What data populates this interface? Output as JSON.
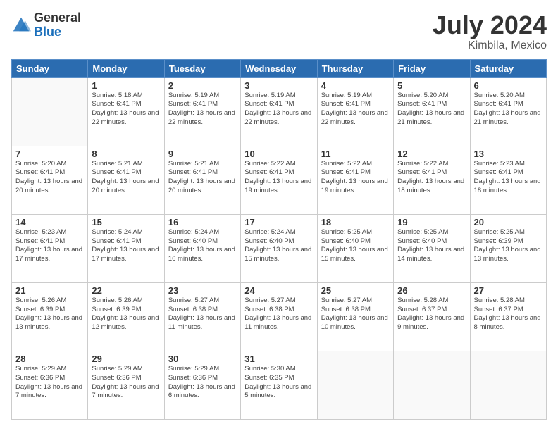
{
  "logo": {
    "general": "General",
    "blue": "Blue"
  },
  "title": "July 2024",
  "subtitle": "Kimbila, Mexico",
  "days": [
    "Sunday",
    "Monday",
    "Tuesday",
    "Wednesday",
    "Thursday",
    "Friday",
    "Saturday"
  ],
  "weeks": [
    [
      {
        "num": "",
        "sunrise": "",
        "sunset": "",
        "daylight": ""
      },
      {
        "num": "1",
        "sunrise": "Sunrise: 5:18 AM",
        "sunset": "Sunset: 6:41 PM",
        "daylight": "Daylight: 13 hours and 22 minutes."
      },
      {
        "num": "2",
        "sunrise": "Sunrise: 5:19 AM",
        "sunset": "Sunset: 6:41 PM",
        "daylight": "Daylight: 13 hours and 22 minutes."
      },
      {
        "num": "3",
        "sunrise": "Sunrise: 5:19 AM",
        "sunset": "Sunset: 6:41 PM",
        "daylight": "Daylight: 13 hours and 22 minutes."
      },
      {
        "num": "4",
        "sunrise": "Sunrise: 5:19 AM",
        "sunset": "Sunset: 6:41 PM",
        "daylight": "Daylight: 13 hours and 22 minutes."
      },
      {
        "num": "5",
        "sunrise": "Sunrise: 5:20 AM",
        "sunset": "Sunset: 6:41 PM",
        "daylight": "Daylight: 13 hours and 21 minutes."
      },
      {
        "num": "6",
        "sunrise": "Sunrise: 5:20 AM",
        "sunset": "Sunset: 6:41 PM",
        "daylight": "Daylight: 13 hours and 21 minutes."
      }
    ],
    [
      {
        "num": "7",
        "sunrise": "Sunrise: 5:20 AM",
        "sunset": "Sunset: 6:41 PM",
        "daylight": "Daylight: 13 hours and 20 minutes."
      },
      {
        "num": "8",
        "sunrise": "Sunrise: 5:21 AM",
        "sunset": "Sunset: 6:41 PM",
        "daylight": "Daylight: 13 hours and 20 minutes."
      },
      {
        "num": "9",
        "sunrise": "Sunrise: 5:21 AM",
        "sunset": "Sunset: 6:41 PM",
        "daylight": "Daylight: 13 hours and 20 minutes."
      },
      {
        "num": "10",
        "sunrise": "Sunrise: 5:22 AM",
        "sunset": "Sunset: 6:41 PM",
        "daylight": "Daylight: 13 hours and 19 minutes."
      },
      {
        "num": "11",
        "sunrise": "Sunrise: 5:22 AM",
        "sunset": "Sunset: 6:41 PM",
        "daylight": "Daylight: 13 hours and 19 minutes."
      },
      {
        "num": "12",
        "sunrise": "Sunrise: 5:22 AM",
        "sunset": "Sunset: 6:41 PM",
        "daylight": "Daylight: 13 hours and 18 minutes."
      },
      {
        "num": "13",
        "sunrise": "Sunrise: 5:23 AM",
        "sunset": "Sunset: 6:41 PM",
        "daylight": "Daylight: 13 hours and 18 minutes."
      }
    ],
    [
      {
        "num": "14",
        "sunrise": "Sunrise: 5:23 AM",
        "sunset": "Sunset: 6:41 PM",
        "daylight": "Daylight: 13 hours and 17 minutes."
      },
      {
        "num": "15",
        "sunrise": "Sunrise: 5:24 AM",
        "sunset": "Sunset: 6:41 PM",
        "daylight": "Daylight: 13 hours and 17 minutes."
      },
      {
        "num": "16",
        "sunrise": "Sunrise: 5:24 AM",
        "sunset": "Sunset: 6:40 PM",
        "daylight": "Daylight: 13 hours and 16 minutes."
      },
      {
        "num": "17",
        "sunrise": "Sunrise: 5:24 AM",
        "sunset": "Sunset: 6:40 PM",
        "daylight": "Daylight: 13 hours and 15 minutes."
      },
      {
        "num": "18",
        "sunrise": "Sunrise: 5:25 AM",
        "sunset": "Sunset: 6:40 PM",
        "daylight": "Daylight: 13 hours and 15 minutes."
      },
      {
        "num": "19",
        "sunrise": "Sunrise: 5:25 AM",
        "sunset": "Sunset: 6:40 PM",
        "daylight": "Daylight: 13 hours and 14 minutes."
      },
      {
        "num": "20",
        "sunrise": "Sunrise: 5:25 AM",
        "sunset": "Sunset: 6:39 PM",
        "daylight": "Daylight: 13 hours and 13 minutes."
      }
    ],
    [
      {
        "num": "21",
        "sunrise": "Sunrise: 5:26 AM",
        "sunset": "Sunset: 6:39 PM",
        "daylight": "Daylight: 13 hours and 13 minutes."
      },
      {
        "num": "22",
        "sunrise": "Sunrise: 5:26 AM",
        "sunset": "Sunset: 6:39 PM",
        "daylight": "Daylight: 13 hours and 12 minutes."
      },
      {
        "num": "23",
        "sunrise": "Sunrise: 5:27 AM",
        "sunset": "Sunset: 6:38 PM",
        "daylight": "Daylight: 13 hours and 11 minutes."
      },
      {
        "num": "24",
        "sunrise": "Sunrise: 5:27 AM",
        "sunset": "Sunset: 6:38 PM",
        "daylight": "Daylight: 13 hours and 11 minutes."
      },
      {
        "num": "25",
        "sunrise": "Sunrise: 5:27 AM",
        "sunset": "Sunset: 6:38 PM",
        "daylight": "Daylight: 13 hours and 10 minutes."
      },
      {
        "num": "26",
        "sunrise": "Sunrise: 5:28 AM",
        "sunset": "Sunset: 6:37 PM",
        "daylight": "Daylight: 13 hours and 9 minutes."
      },
      {
        "num": "27",
        "sunrise": "Sunrise: 5:28 AM",
        "sunset": "Sunset: 6:37 PM",
        "daylight": "Daylight: 13 hours and 8 minutes."
      }
    ],
    [
      {
        "num": "28",
        "sunrise": "Sunrise: 5:29 AM",
        "sunset": "Sunset: 6:36 PM",
        "daylight": "Daylight: 13 hours and 7 minutes."
      },
      {
        "num": "29",
        "sunrise": "Sunrise: 5:29 AM",
        "sunset": "Sunset: 6:36 PM",
        "daylight": "Daylight: 13 hours and 7 minutes."
      },
      {
        "num": "30",
        "sunrise": "Sunrise: 5:29 AM",
        "sunset": "Sunset: 6:36 PM",
        "daylight": "Daylight: 13 hours and 6 minutes."
      },
      {
        "num": "31",
        "sunrise": "Sunrise: 5:30 AM",
        "sunset": "Sunset: 6:35 PM",
        "daylight": "Daylight: 13 hours and 5 minutes."
      },
      {
        "num": "",
        "sunrise": "",
        "sunset": "",
        "daylight": ""
      },
      {
        "num": "",
        "sunrise": "",
        "sunset": "",
        "daylight": ""
      },
      {
        "num": "",
        "sunrise": "",
        "sunset": "",
        "daylight": ""
      }
    ]
  ]
}
